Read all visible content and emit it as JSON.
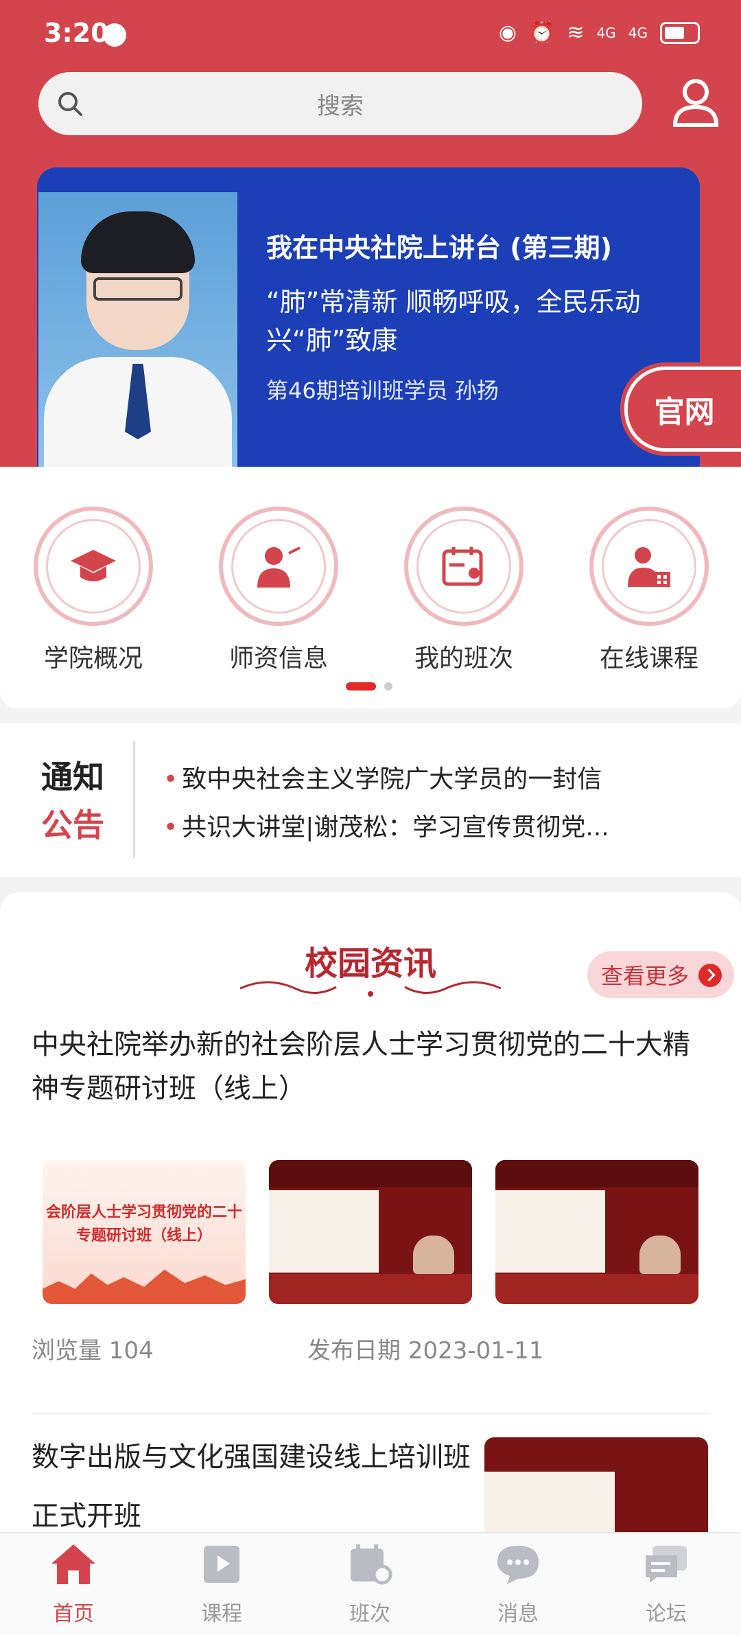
{
  "status_bar": {
    "time": "3:20",
    "network": "4G",
    "network2": "4G"
  },
  "search": {
    "placeholder": "搜索"
  },
  "banner": {
    "title": "我在中央社院上讲台 (第三期)",
    "subtitle": "“肺”常清新 顺畅呼吸，全民乐动 兴“肺”致康",
    "author": "第46期培训班学员 孙扬",
    "official_label": "官网"
  },
  "quick_links": [
    {
      "label": "学院概况",
      "icon": "graduation-cap-icon"
    },
    {
      "label": "师资信息",
      "icon": "teacher-icon"
    },
    {
      "label": "我的班次",
      "icon": "calendar-person-icon"
    },
    {
      "label": "在线课程",
      "icon": "online-course-icon"
    }
  ],
  "notice": {
    "label_top": "通知",
    "label_bottom": "公告",
    "items": [
      "致中央社会主义学院广大学员的一封信",
      "共识大讲堂|谢茂松：学习宣传贯彻党..."
    ]
  },
  "news": {
    "section_title": "校园资讯",
    "more_label": "查看更多",
    "articles": [
      {
        "title": "中央社院举办新的社会阶层人士学习贯彻党的二十大精神专题研讨班（线上）",
        "views": "浏览量 104",
        "date": "发布日期 2023-01-11",
        "thumb_text": "会阶层人士学习贯彻党的二十 专题研讨班（线上）"
      },
      {
        "title": "数字出版与文化强国建设线上培训班正式开班"
      }
    ]
  },
  "tabs": [
    {
      "label": "首页",
      "icon": "home-icon",
      "active": true
    },
    {
      "label": "课程",
      "icon": "course-icon",
      "active": false
    },
    {
      "label": "班次",
      "icon": "class-icon",
      "active": false
    },
    {
      "label": "消息",
      "icon": "message-icon",
      "active": false
    },
    {
      "label": "论坛",
      "icon": "forum-icon",
      "active": false
    }
  ],
  "colors": {
    "brand": "#d4444c",
    "banner_blue": "#1c3fb8"
  }
}
